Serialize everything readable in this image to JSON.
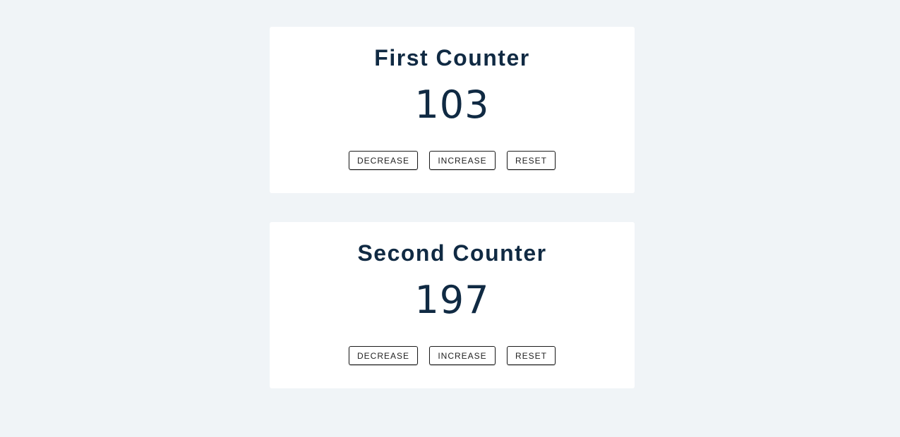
{
  "counters": [
    {
      "title": "First Counter",
      "value": "103",
      "decrease_label": "DECREASE",
      "increase_label": "INCREASE",
      "reset_label": "RESET"
    },
    {
      "title": "Second Counter",
      "value": "197",
      "decrease_label": "DECREASE",
      "increase_label": "INCREASE",
      "reset_label": "RESET"
    }
  ],
  "colors": {
    "background": "#f0f4f7",
    "card": "#ffffff",
    "text": "#102a43",
    "button_border": "#1b1b1b"
  }
}
